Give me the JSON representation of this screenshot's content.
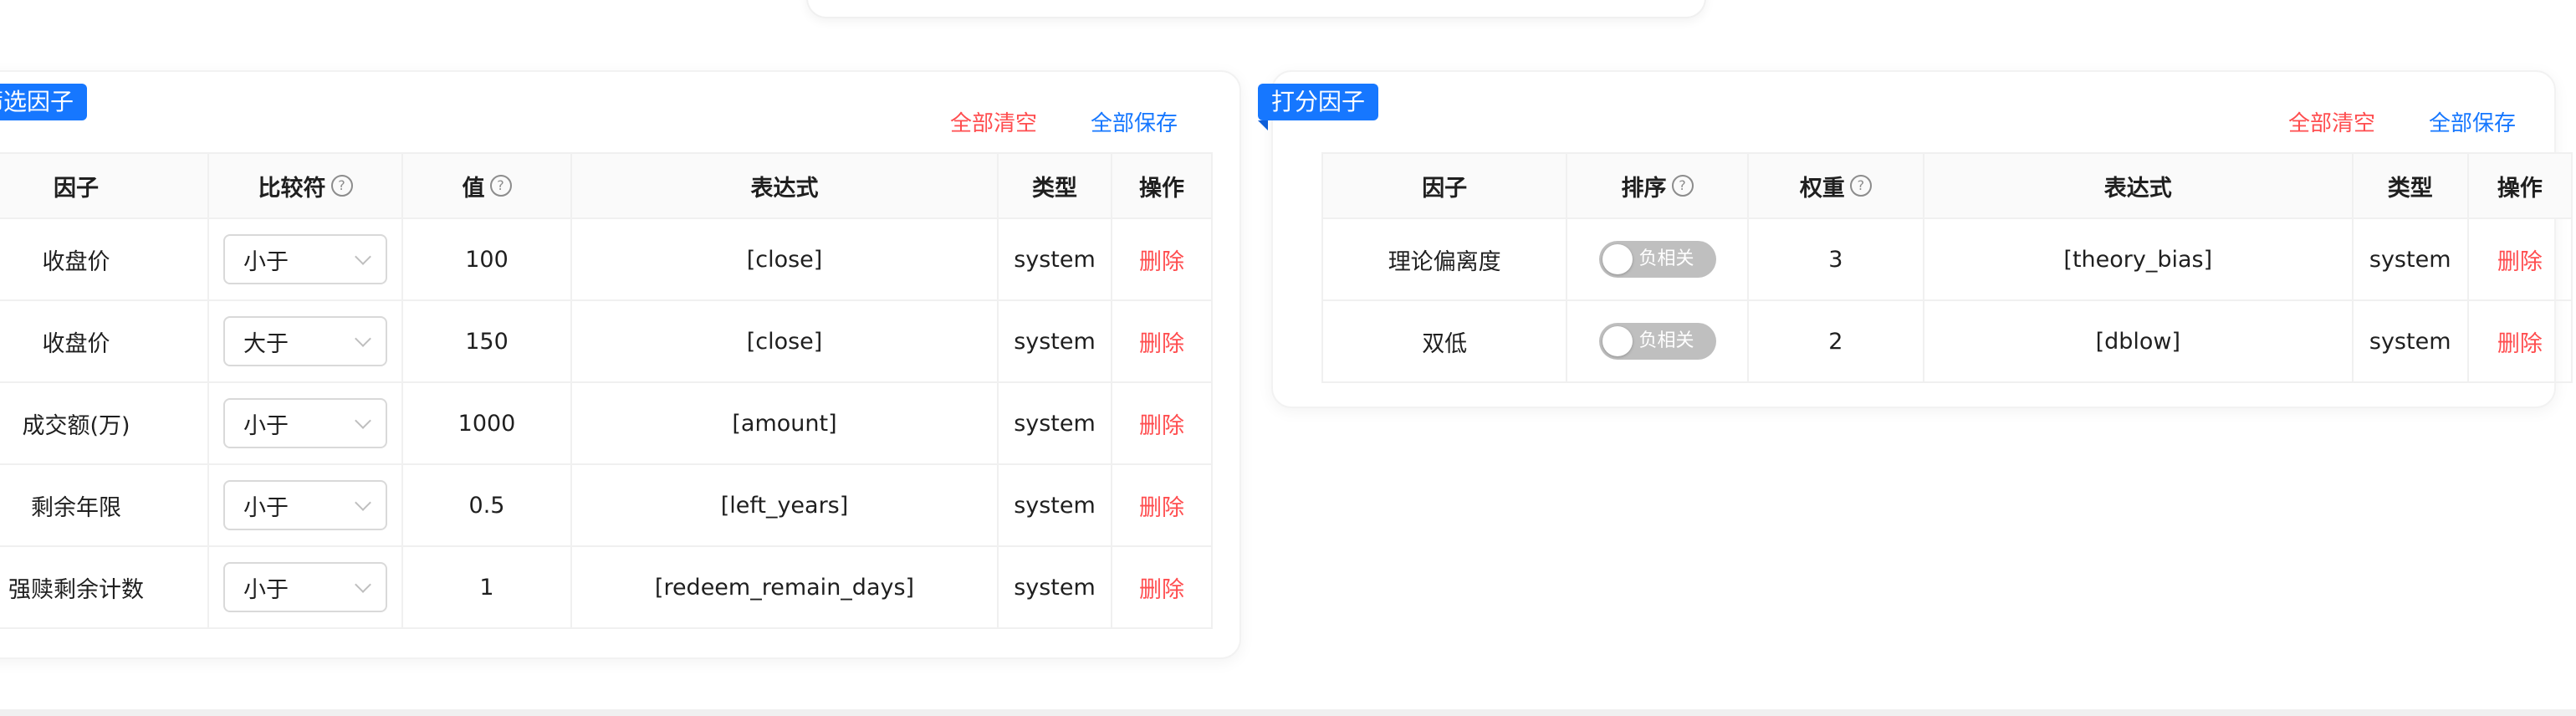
{
  "filter_panel": {
    "title": "筛选因子",
    "clear_all": "全部清空",
    "save_all": "全部保存",
    "columns": [
      "因子",
      "比较符",
      "值",
      "表达式",
      "类型",
      "操作"
    ],
    "rows": [
      {
        "factor": "收盘价",
        "comparator": "小于",
        "value": "100",
        "expression": "[close]",
        "type": "system",
        "action": "删除"
      },
      {
        "factor": "收盘价",
        "comparator": "大于",
        "value": "150",
        "expression": "[close]",
        "type": "system",
        "action": "删除"
      },
      {
        "factor": "成交额(万)",
        "comparator": "小于",
        "value": "1000",
        "expression": "[amount]",
        "type": "system",
        "action": "删除"
      },
      {
        "factor": "剩余年限",
        "comparator": "小于",
        "value": "0.5",
        "expression": "[left_years]",
        "type": "system",
        "action": "删除"
      },
      {
        "factor": "强赎剩余计数",
        "comparator": "小于",
        "value": "1",
        "expression": "[redeem_remain_days]",
        "type": "system",
        "action": "删除"
      }
    ]
  },
  "score_panel": {
    "title": "打分因子",
    "clear_all": "全部清空",
    "save_all": "全部保存",
    "columns": [
      "因子",
      "排序",
      "权重",
      "表达式",
      "类型",
      "操作"
    ],
    "rows": [
      {
        "factor": "理论偏离度",
        "sort": "负相关",
        "weight": "3",
        "expression": "[theory_bias]",
        "type": "system",
        "action": "删除"
      },
      {
        "factor": "双低",
        "sort": "负相关",
        "weight": "2",
        "expression": "[dblow]",
        "type": "system",
        "action": "删除"
      }
    ]
  },
  "icons": {
    "help": "?",
    "help_name": "question-circle-icon",
    "dropdown": "chevron-down-icon"
  },
  "colors": {
    "primary": "#1677ff",
    "danger": "#ff4d4f",
    "switch_off": "#bfbfbf",
    "header_bg": "#fafafa"
  }
}
